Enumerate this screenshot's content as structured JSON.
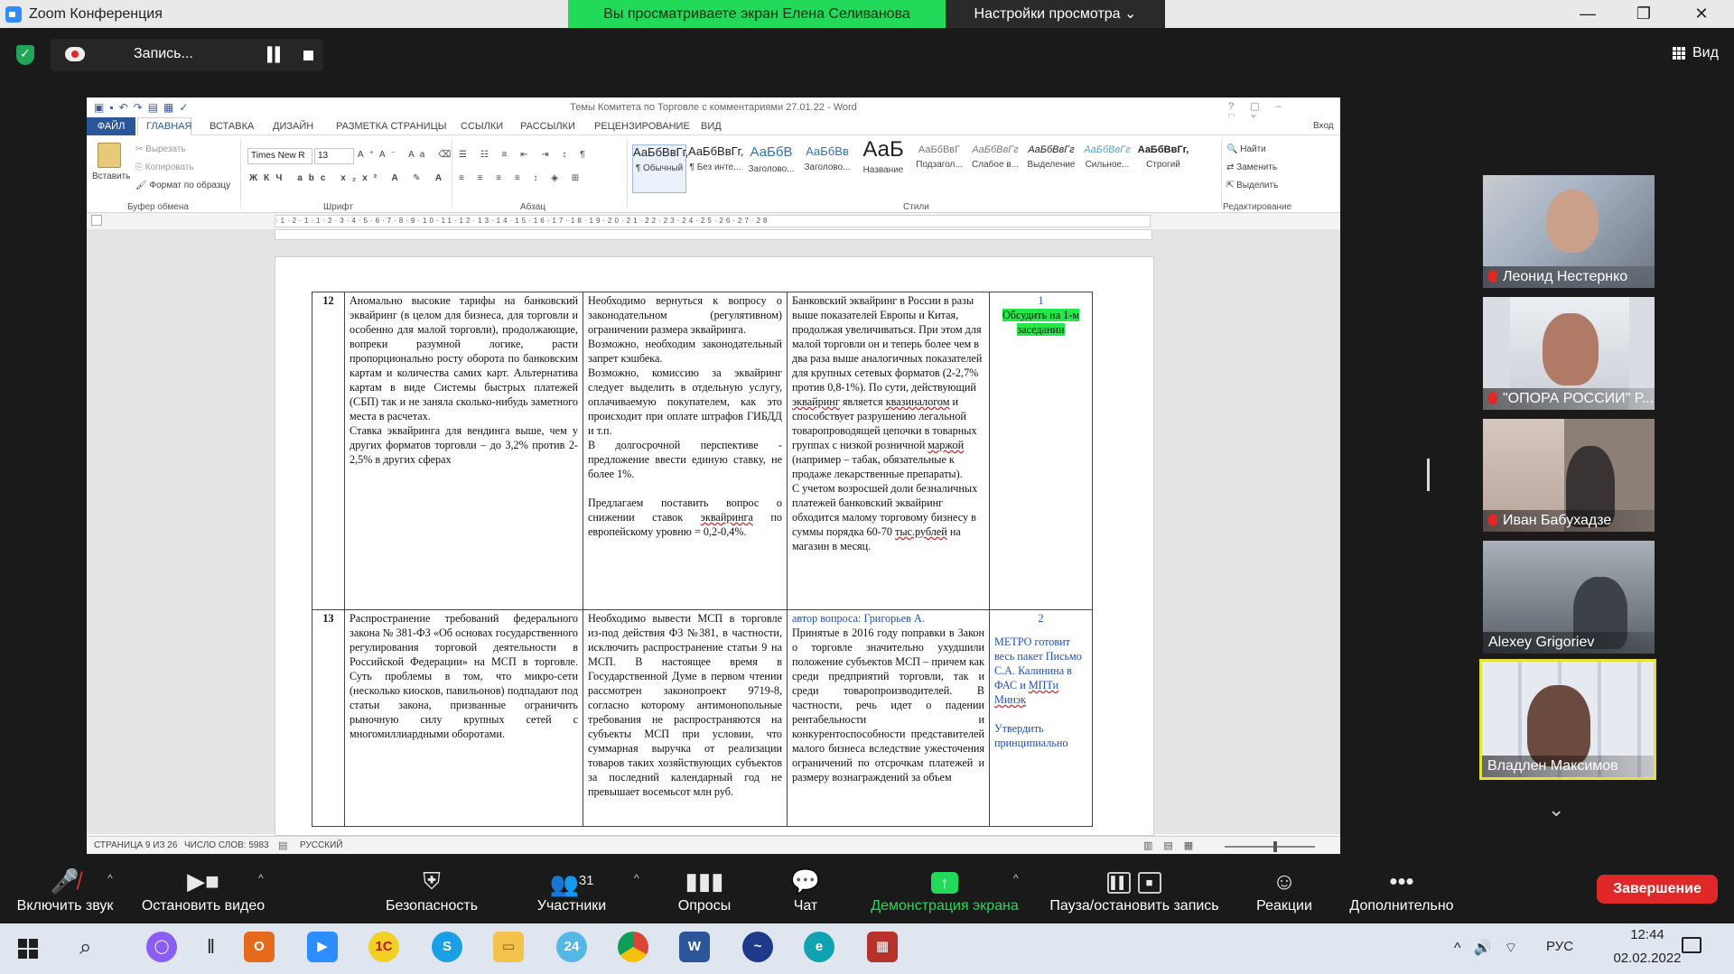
{
  "zoom": {
    "app_title": "Zoom Конференция",
    "share_banner": "Вы просматриваете экран Елена Селиванова",
    "view_settings": "Настройки просмотра ⌄",
    "recording_label": "Запись...",
    "view_label": "Вид",
    "window_controls": [
      "—",
      "❐",
      "✕"
    ]
  },
  "word": {
    "doc_title": "Темы Комитета по Торговле с комментариями 27.01.22 - Word",
    "file_tab": "ФАЙЛ",
    "tabs": [
      "ГЛАВНАЯ",
      "ВСТАВКА",
      "ДИЗАЙН",
      "РАЗМЕТКА СТРАНИЦЫ",
      "ССЫЛКИ",
      "РАССЫЛКИ",
      "РЕЦЕНЗИРОВАНИЕ",
      "ВИД"
    ],
    "sign_in": "Вход",
    "clipboard": {
      "paste": "Вставить",
      "cut": "Вырезать",
      "copy": "Копировать",
      "format_painter": "Формат по образцу",
      "group": "Буфер обмена"
    },
    "font": {
      "name": "Times New R",
      "size": "13",
      "group": "Шрифт"
    },
    "paragraph_group": "Абзац",
    "styles": [
      {
        "sample": "АаБбВвГг,",
        "name": "¶ Обычный"
      },
      {
        "sample": "АаБбВвГг,",
        "name": "¶ Без инте..."
      },
      {
        "sample": "АаБбВ",
        "name": "Заголово..."
      },
      {
        "sample": "АаБбВв",
        "name": "Заголово..."
      },
      {
        "sample": "АаБ",
        "name": "Название"
      },
      {
        "sample": "АаБбВвГ",
        "name": "Подзагол..."
      },
      {
        "sample": "АаБбВвГг",
        "name": "Слабое в..."
      },
      {
        "sample": "АаБбВвГг",
        "name": "Выделение"
      },
      {
        "sample": "АаБбВвГг",
        "name": "Сильное..."
      },
      {
        "sample": "АаБбВвГг,",
        "name": "Строгий"
      }
    ],
    "styles_group": "Стили",
    "editing": {
      "find": "Найти",
      "replace": "Заменить",
      "select": "Выделить",
      "group": "Редактирование"
    },
    "status": {
      "page": "СТРАНИЦА 9 ИЗ 26",
      "words": "ЧИСЛО СЛОВ: 5983",
      "language": "РУССКИЙ"
    },
    "table": {
      "row12": {
        "num": "12",
        "col1": "Аномально высокие тарифы на банковский эквайринг (в целом для бизнеса, для торговли и особенно для малой торговли), продолжающие, вопреки разумной логике, расти пропорционально росту оборота по банковским картам и количества самих карт. Альтернатива картам в виде Системы быстрых платежей (СБП) так и не заняла сколько-нибудь заметного места в расчетах.",
        "col1b": "Ставка эквайринга для вендинга выше, чем у других форматов торговли – до 3,2% против 2-2,5% в других сферах",
        "col2a": "Необходимо вернуться к вопросу о законодательном (регулятивном) ограничении размера эквайринга.",
        "col2b": "Возможно, необходим законодательный запрет кэшбека.",
        "col2c": "Возможно, комиссию за эквайринг следует выделить в отдельную услугу, оплачиваемую покупателем, как это происходит при оплате штрафов ГИБДД и т.п.",
        "col2d": "В долгосрочной перспективе - предложение ввести единую ставку, не более 1%.",
        "col2e_1": "Предлагаем поставить вопрос о снижении ставок",
        "col2e_u": "эквайринга",
        "col2e_2": "по европейскому уровню = 0,2-0,4%.",
        "col3a": "Банковский эквайринг в России в разы выше показателей Европы и Китая, продолжая увеличиваться. При этом для малой торговли он и теперь более чем в два раза выше аналогичных показателей для крупных сетевых форматов (2-2,7% против 0,8-1%). По сути, действующий",
        "col3a_u": "эквайринг",
        "col3a_2": "является",
        "col3b_u": "квазиналогом",
        "col3b": "и способствует разрушению легальной товаропроводящей цепочки в товарных группах с низкой розничной",
        "col3b_u2": "маржой",
        "col3b_2": "(например – табак, обязательные к продаже лекарственные препараты).",
        "col3c": "С учетом возросшей доли безналичных платежей банковский эквайринг обходится малому торговому бизнесу в суммы порядка 60-70",
        "col3c_u": "тыс.рублей",
        "col3c_2": "на магазин в месяц.",
        "col4_num": "1",
        "col4_note": "Обсудить на 1-м заседании"
      },
      "row13": {
        "num": "13",
        "col1": "Распространение требований федерального закона № 381-ФЗ «Об основах государственного регулирования торговой деятельности в Российской Федерации» на МСП в торговле. Суть проблемы в том, что микро-сети (несколько киосков, павильонов) подпадают под статьи закона, призванные ограничить рыночную силу крупных сетей с многомиллиардными оборотами.",
        "col2": "Необходимо вывести МСП в торговле из-под действия ФЗ №381, в частности, исключить распространение статьи 9 на МСП. В настоящее время в Государственной Думе в первом чтении рассмотрен законопроект 9719-8, согласно которому антимонопольные требования не распространяются на субъекты МСП при условии, что суммарная выручка от реализации товаров таких хозяйствующих субъектов за последний календарный год не превышает восемьсот млн руб.",
        "col3_author": "автор вопроса: Григорьев А.",
        "col3": "Принятые в 2016 году поправки в Закон о торговле значительно ухудшили положение субъектов МСП – причем как среди предприятий торговли, так и среди товаропроизводителей. В частности, речь идет о падении рентабельности и конкурентоспособности представителей малого бизнеса вследствие ужесточения ограничений по отсрочкам платежей и размеру вознаграждений за объем",
        "col4_num": "2",
        "col4_a": "МЕТРО готовит весь пакет Письмо С.А. Калинина в ФАС и",
        "col4_u1": "МПТи",
        "col4_u2": "Минэк",
        "col4_b": "Утвердить принципиально"
      }
    }
  },
  "participants": [
    {
      "name": "Леонид Нестернко",
      "muted": true,
      "tone": "#8e9aa6"
    },
    {
      "name": "\"ОПОРА РОССИИ\" Р...",
      "muted": true,
      "tone": "#b9bfc8"
    },
    {
      "name": "Иван Бабухадзе",
      "muted": true,
      "tone": "#8b7f78"
    },
    {
      "name": "Alexey Grigoriev",
      "muted": false,
      "tone": "#7c8288"
    },
    {
      "name": "Владлен Максимов",
      "muted": false,
      "tone": "#9aa4b0",
      "active": true
    }
  ],
  "toolbar": {
    "unmute": "Включить звук",
    "stop_video": "Остановить видео",
    "security": "Безопасность",
    "participants": "Участники",
    "participants_count": "31",
    "polls": "Опросы",
    "chat": "Чат",
    "share_screen": "Демонстрация экрана",
    "pause_record": "Пауза/остановить запись",
    "reactions": "Реакции",
    "more": "Дополнительно",
    "end": "Завершение"
  },
  "taskbar": {
    "language": "РУС",
    "time": "12:44",
    "date": "02.02.2022"
  },
  "colors": {
    "share_green": "#23d959",
    "end_red": "#e02828",
    "word_blue": "#2b579a",
    "active_speaker": "#e5e23c"
  }
}
